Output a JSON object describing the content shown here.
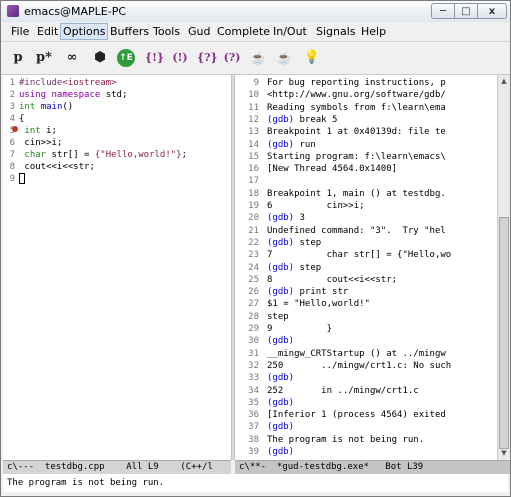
{
  "window": {
    "title": "emacs@MAPLE-PC",
    "close_label": "x"
  },
  "menu": [
    "File",
    "Edit",
    "Options",
    "Buffers",
    "Tools",
    "Gud",
    "Complete",
    "In/Out",
    "Signals",
    "Help"
  ],
  "toolbar": {
    "icons": [
      "p",
      "p*",
      "glasses",
      "go",
      "{}",
      "(!)",
      "{?}",
      "(?)",
      "drink",
      "drink-star",
      "bulb"
    ],
    "glyphs": [
      "p",
      "p*",
      "∞",
      "⬢",
      "{!}",
      "(!)",
      "{?}",
      "(?)",
      "☕",
      "☕",
      "💡"
    ]
  },
  "source": {
    "lines": [
      {
        "n": "1",
        "parts": [
          [
            "pre",
            "#include"
          ],
          [
            "str",
            "<iostream>"
          ]
        ]
      },
      {
        "n": "2",
        "parts": [
          [
            "kw",
            "using"
          ],
          [
            "",
            ""
          ],
          [
            "kw",
            " namespace"
          ],
          [
            "",
            " std;"
          ]
        ]
      },
      {
        "n": "3",
        "parts": [
          [
            "ty",
            "int"
          ],
          [
            "",
            " "
          ],
          [
            "fn",
            "main"
          ],
          [
            "",
            "()"
          ]
        ]
      },
      {
        "n": "4",
        "parts": [
          [
            "",
            "{"
          ]
        ]
      },
      {
        "n": "5",
        "parts": [
          [
            "",
            " "
          ],
          [
            "ty",
            "int"
          ],
          [
            "",
            " i;"
          ]
        ]
      },
      {
        "n": "6",
        "parts": [
          [
            "",
            " cin>>i;"
          ]
        ]
      },
      {
        "n": "7",
        "parts": [
          [
            "",
            " "
          ],
          [
            "ty",
            "char"
          ],
          [
            "",
            " str[] = "
          ],
          [
            "str",
            "{\"Hello,world!\"}"
          ],
          [
            "",
            ";"
          ]
        ]
      },
      {
        "n": "8",
        "parts": [
          [
            "",
            " cout<<i<<str;"
          ]
        ]
      },
      {
        "n": "9",
        "parts": [
          [
            "",
            ""
          ]
        ]
      }
    ]
  },
  "gud": {
    "lines": [
      {
        "n": "9",
        "parts": [
          [
            "",
            "For bug reporting instructions, p"
          ]
        ]
      },
      {
        "n": "10",
        "parts": [
          [
            "",
            "<http://www.gnu.org/software/gdb/"
          ]
        ]
      },
      {
        "n": "11",
        "parts": [
          [
            "",
            "Reading symbols from f:\\learn\\ema"
          ]
        ]
      },
      {
        "n": "12",
        "parts": [
          [
            "gdbp",
            "(gdb)"
          ],
          [
            "",
            " break 5"
          ]
        ]
      },
      {
        "n": "13",
        "parts": [
          [
            "",
            "Breakpoint 1 at 0x40139d: file te"
          ]
        ]
      },
      {
        "n": "14",
        "parts": [
          [
            "gdbp",
            "(gdb)"
          ],
          [
            "",
            " run"
          ]
        ]
      },
      {
        "n": "15",
        "parts": [
          [
            "",
            "Starting program: f:\\learn\\emacs\\"
          ]
        ]
      },
      {
        "n": "16",
        "parts": [
          [
            "",
            "[New Thread 4564.0x1400]"
          ]
        ]
      },
      {
        "n": "17",
        "parts": [
          [
            "",
            ""
          ]
        ]
      },
      {
        "n": "18",
        "parts": [
          [
            "",
            "Breakpoint 1, main () at testdbg."
          ]
        ]
      },
      {
        "n": "19",
        "parts": [
          [
            "",
            "6          cin>>i;"
          ]
        ]
      },
      {
        "n": "20",
        "parts": [
          [
            "gdbp",
            "(gdb)"
          ],
          [
            "",
            " 3"
          ]
        ]
      },
      {
        "n": "21",
        "parts": [
          [
            "",
            "Undefined command: \"3\".  Try \"hel"
          ]
        ]
      },
      {
        "n": "22",
        "parts": [
          [
            "gdbp",
            "(gdb)"
          ],
          [
            "",
            " step"
          ]
        ]
      },
      {
        "n": "23",
        "parts": [
          [
            "",
            "7          char str[] = {\"Hello,wo"
          ]
        ]
      },
      {
        "n": "24",
        "parts": [
          [
            "gdbp",
            "(gdb)"
          ],
          [
            "",
            " step"
          ]
        ]
      },
      {
        "n": "25",
        "parts": [
          [
            "",
            "8          cout<<i<<str;"
          ]
        ]
      },
      {
        "n": "26",
        "parts": [
          [
            "gdbp",
            "(gdb)"
          ],
          [
            "",
            " print str"
          ]
        ]
      },
      {
        "n": "27",
        "parts": [
          [
            "",
            "$1 = \"Hello,world!\""
          ]
        ]
      },
      {
        "n": "28",
        "parts": [
          [
            "",
            "step"
          ]
        ]
      },
      {
        "n": "29",
        "parts": [
          [
            "",
            "9          }"
          ]
        ]
      },
      {
        "n": "30",
        "parts": [
          [
            "gdbp",
            "(gdb)"
          ]
        ]
      },
      {
        "n": "31",
        "parts": [
          [
            "",
            "__mingw_CRTStartup () at ../mingw"
          ]
        ]
      },
      {
        "n": "32",
        "parts": [
          [
            "",
            "250       ../mingw/crt1.c: No such"
          ]
        ]
      },
      {
        "n": "33",
        "parts": [
          [
            "gdbp",
            "(gdb)"
          ]
        ]
      },
      {
        "n": "34",
        "parts": [
          [
            "",
            "252       in ../mingw/crt1.c"
          ]
        ]
      },
      {
        "n": "35",
        "parts": [
          [
            "gdbp",
            "(gdb)"
          ]
        ]
      },
      {
        "n": "36",
        "parts": [
          [
            "",
            "[Inferior 1 (process 4564) exited"
          ]
        ]
      },
      {
        "n": "37",
        "parts": [
          [
            "gdbp",
            "(gdb)"
          ]
        ]
      },
      {
        "n": "38",
        "parts": [
          [
            "",
            "The program is not being run."
          ]
        ]
      },
      {
        "n": "39",
        "parts": [
          [
            "gdbp",
            "(gdb)"
          ]
        ]
      }
    ]
  },
  "modeline_left": "c\\---  testdbg.cpp    All L9    (C++/l",
  "modeline_right": "c\\**-  *gud-testdbg.exe*   Bot L39",
  "echo": "The program is not being run."
}
